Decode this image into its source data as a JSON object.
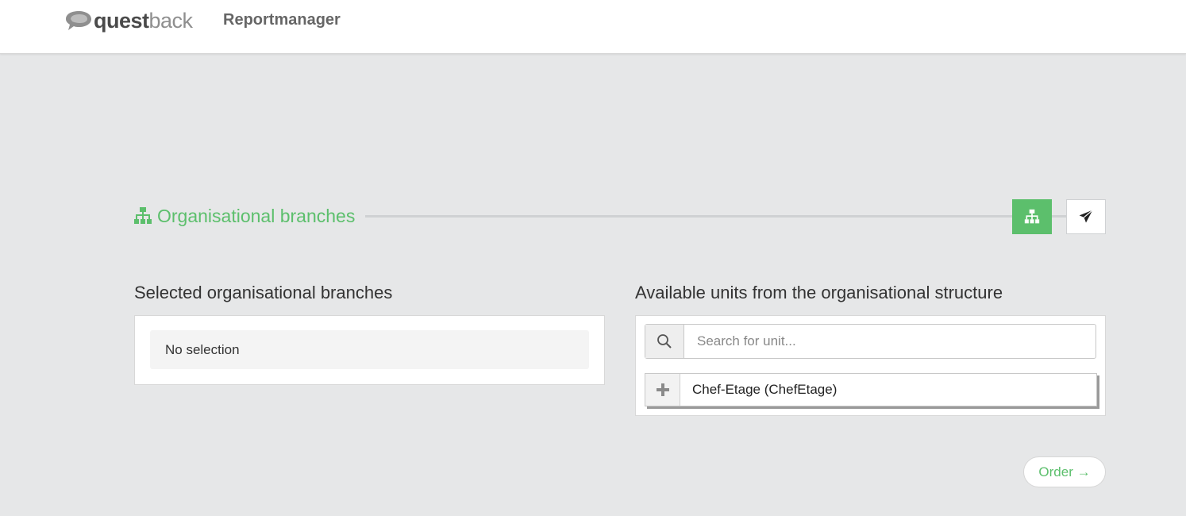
{
  "header": {
    "brand_part1": "quest",
    "brand_part2": "back",
    "app_name": "Reportmanager"
  },
  "steps": {
    "current_title": "Organisational branches",
    "items": [
      {
        "icon": "org-chart-icon",
        "active": true
      },
      {
        "icon": "paper-plane-icon",
        "active": false
      }
    ]
  },
  "selected": {
    "title": "Selected organisational branches",
    "empty_text": "No selection"
  },
  "available": {
    "title": "Available units from the organisational structure",
    "search_placeholder": "Search for unit...",
    "units": [
      {
        "label": "Chef-Etage (ChefEtage)"
      }
    ]
  },
  "footer": {
    "order_label": "Order →"
  },
  "colors": {
    "accent": "#5cbf6c",
    "background": "#e6e7e8"
  }
}
